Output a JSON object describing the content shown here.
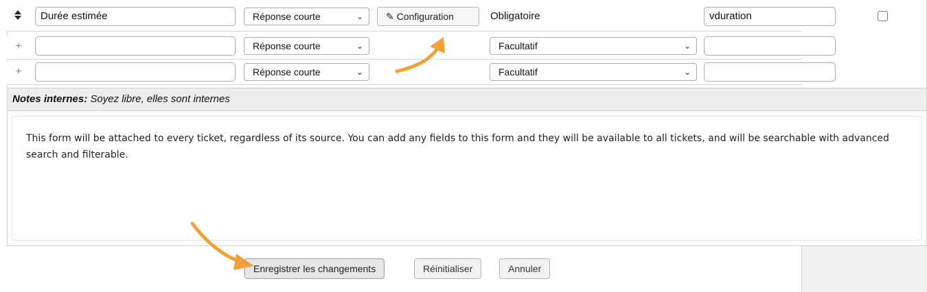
{
  "fields": [
    {
      "handle_icon": "drag-handle-icon",
      "label": "Durée estimée",
      "type": "Réponse courte",
      "config_label": "Configuration",
      "config_icon": "edit-icon",
      "requirement_text": "Obligatoire",
      "variable": "vduration",
      "checked": false
    },
    {
      "handle_icon": "add-icon",
      "label": "",
      "type": "Réponse courte",
      "requirement": "Facultatif",
      "variable": ""
    },
    {
      "handle_icon": "add-icon",
      "label": "",
      "type": "Réponse courte",
      "requirement": "Facultatif",
      "variable": ""
    }
  ],
  "notes": {
    "label": "Notes internes:",
    "text": "Soyez libre, elles sont internes"
  },
  "description": "This form will be attached to every ticket, regardless of its source. You can add any fields to this form and they will be available to all tickets, and will be searchable with advanced search and filterable.",
  "footer": {
    "save_label": "Enregistrer les changements",
    "reset_label": "Réinitialiser",
    "cancel_label": "Annuler"
  },
  "colors": {
    "annotation_arrow": "#f0a139"
  },
  "icons": {
    "drag": "↕",
    "plus": "+",
    "edit": "✎",
    "chevron": "⌄"
  }
}
